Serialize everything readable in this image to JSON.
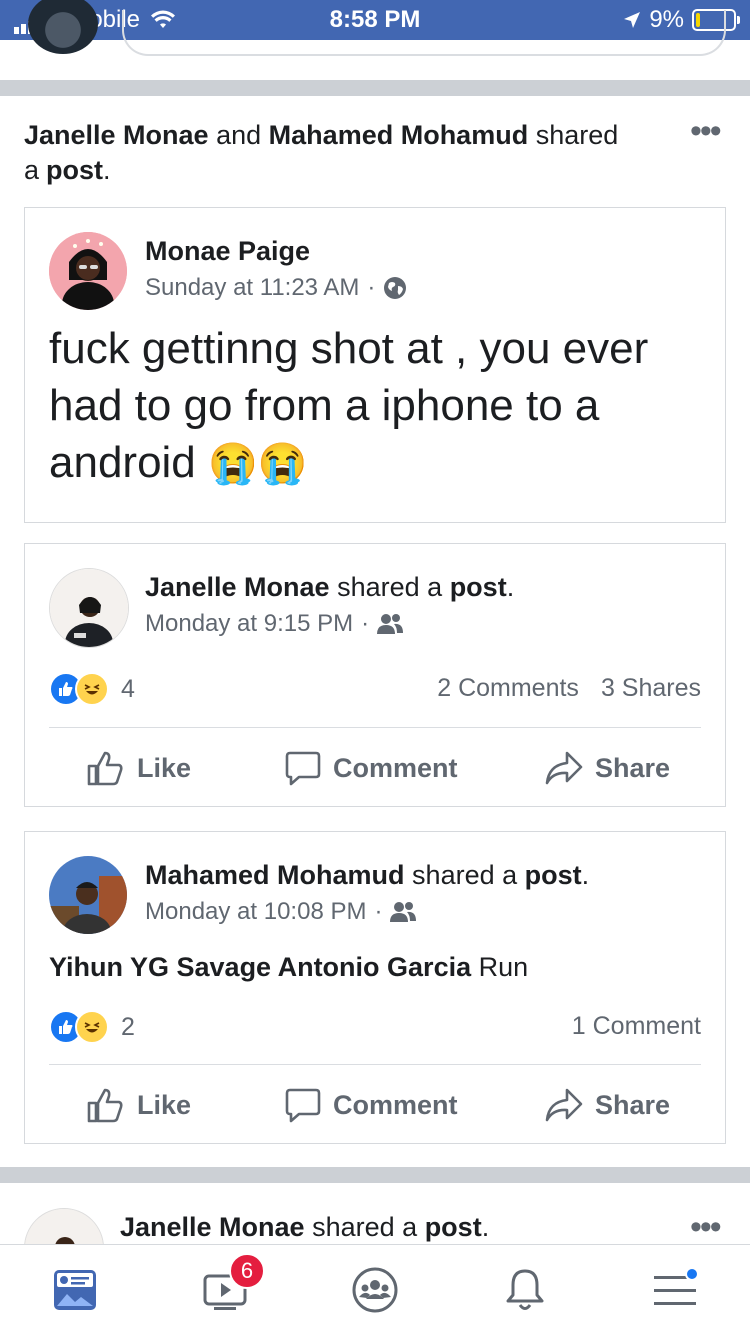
{
  "status_bar": {
    "carrier": "T-Mobile",
    "time": "8:58 PM",
    "battery": "9%"
  },
  "shared_header": {
    "name1": "Janelle Monae",
    "and": "and",
    "name2": "Mahamed Mohamud",
    "shared": "shared",
    "a": "a",
    "post": "post",
    "period": "."
  },
  "original_post": {
    "author": "Monae Paige",
    "time": "Sunday at 11:23 AM",
    "sep": "·",
    "text_line1": "fuck gettinng shot at , you ever",
    "text_line2": "had to go from a iphone to a",
    "text_line3": "android",
    "emoji": "😭😭"
  },
  "share1": {
    "name": "Janelle Monae",
    "shared": "shared a",
    "post": "post",
    "period": ".",
    "time": "Monday at 9:15 PM",
    "sep": "·",
    "reaction_count": "4",
    "comments": "2 Comments",
    "shares": "3 Shares",
    "like": "Like",
    "comment": "Comment",
    "share": "Share"
  },
  "share2": {
    "name": "Mahamed Mohamud",
    "shared": "shared a",
    "post": "post",
    "period": ".",
    "time": "Monday at 10:08 PM",
    "sep": "·",
    "tags": "Yihun YG Savage Antonio Garcia",
    "message": "Run",
    "reaction_count": "2",
    "comments": "1 Comment",
    "like": "Like",
    "comment": "Comment",
    "share": "Share"
  },
  "next_story": {
    "name": "Janelle Monae",
    "shared": "shared a",
    "post": "post",
    "period": "."
  },
  "bottom_nav": {
    "watch_badge": "6",
    "items": [
      "news-feed",
      "watch",
      "groups",
      "notifications",
      "menu"
    ]
  },
  "colors": {
    "brand_blue": "#4267b2",
    "like_blue": "#1877f2",
    "badge_red": "#e41e3f"
  }
}
